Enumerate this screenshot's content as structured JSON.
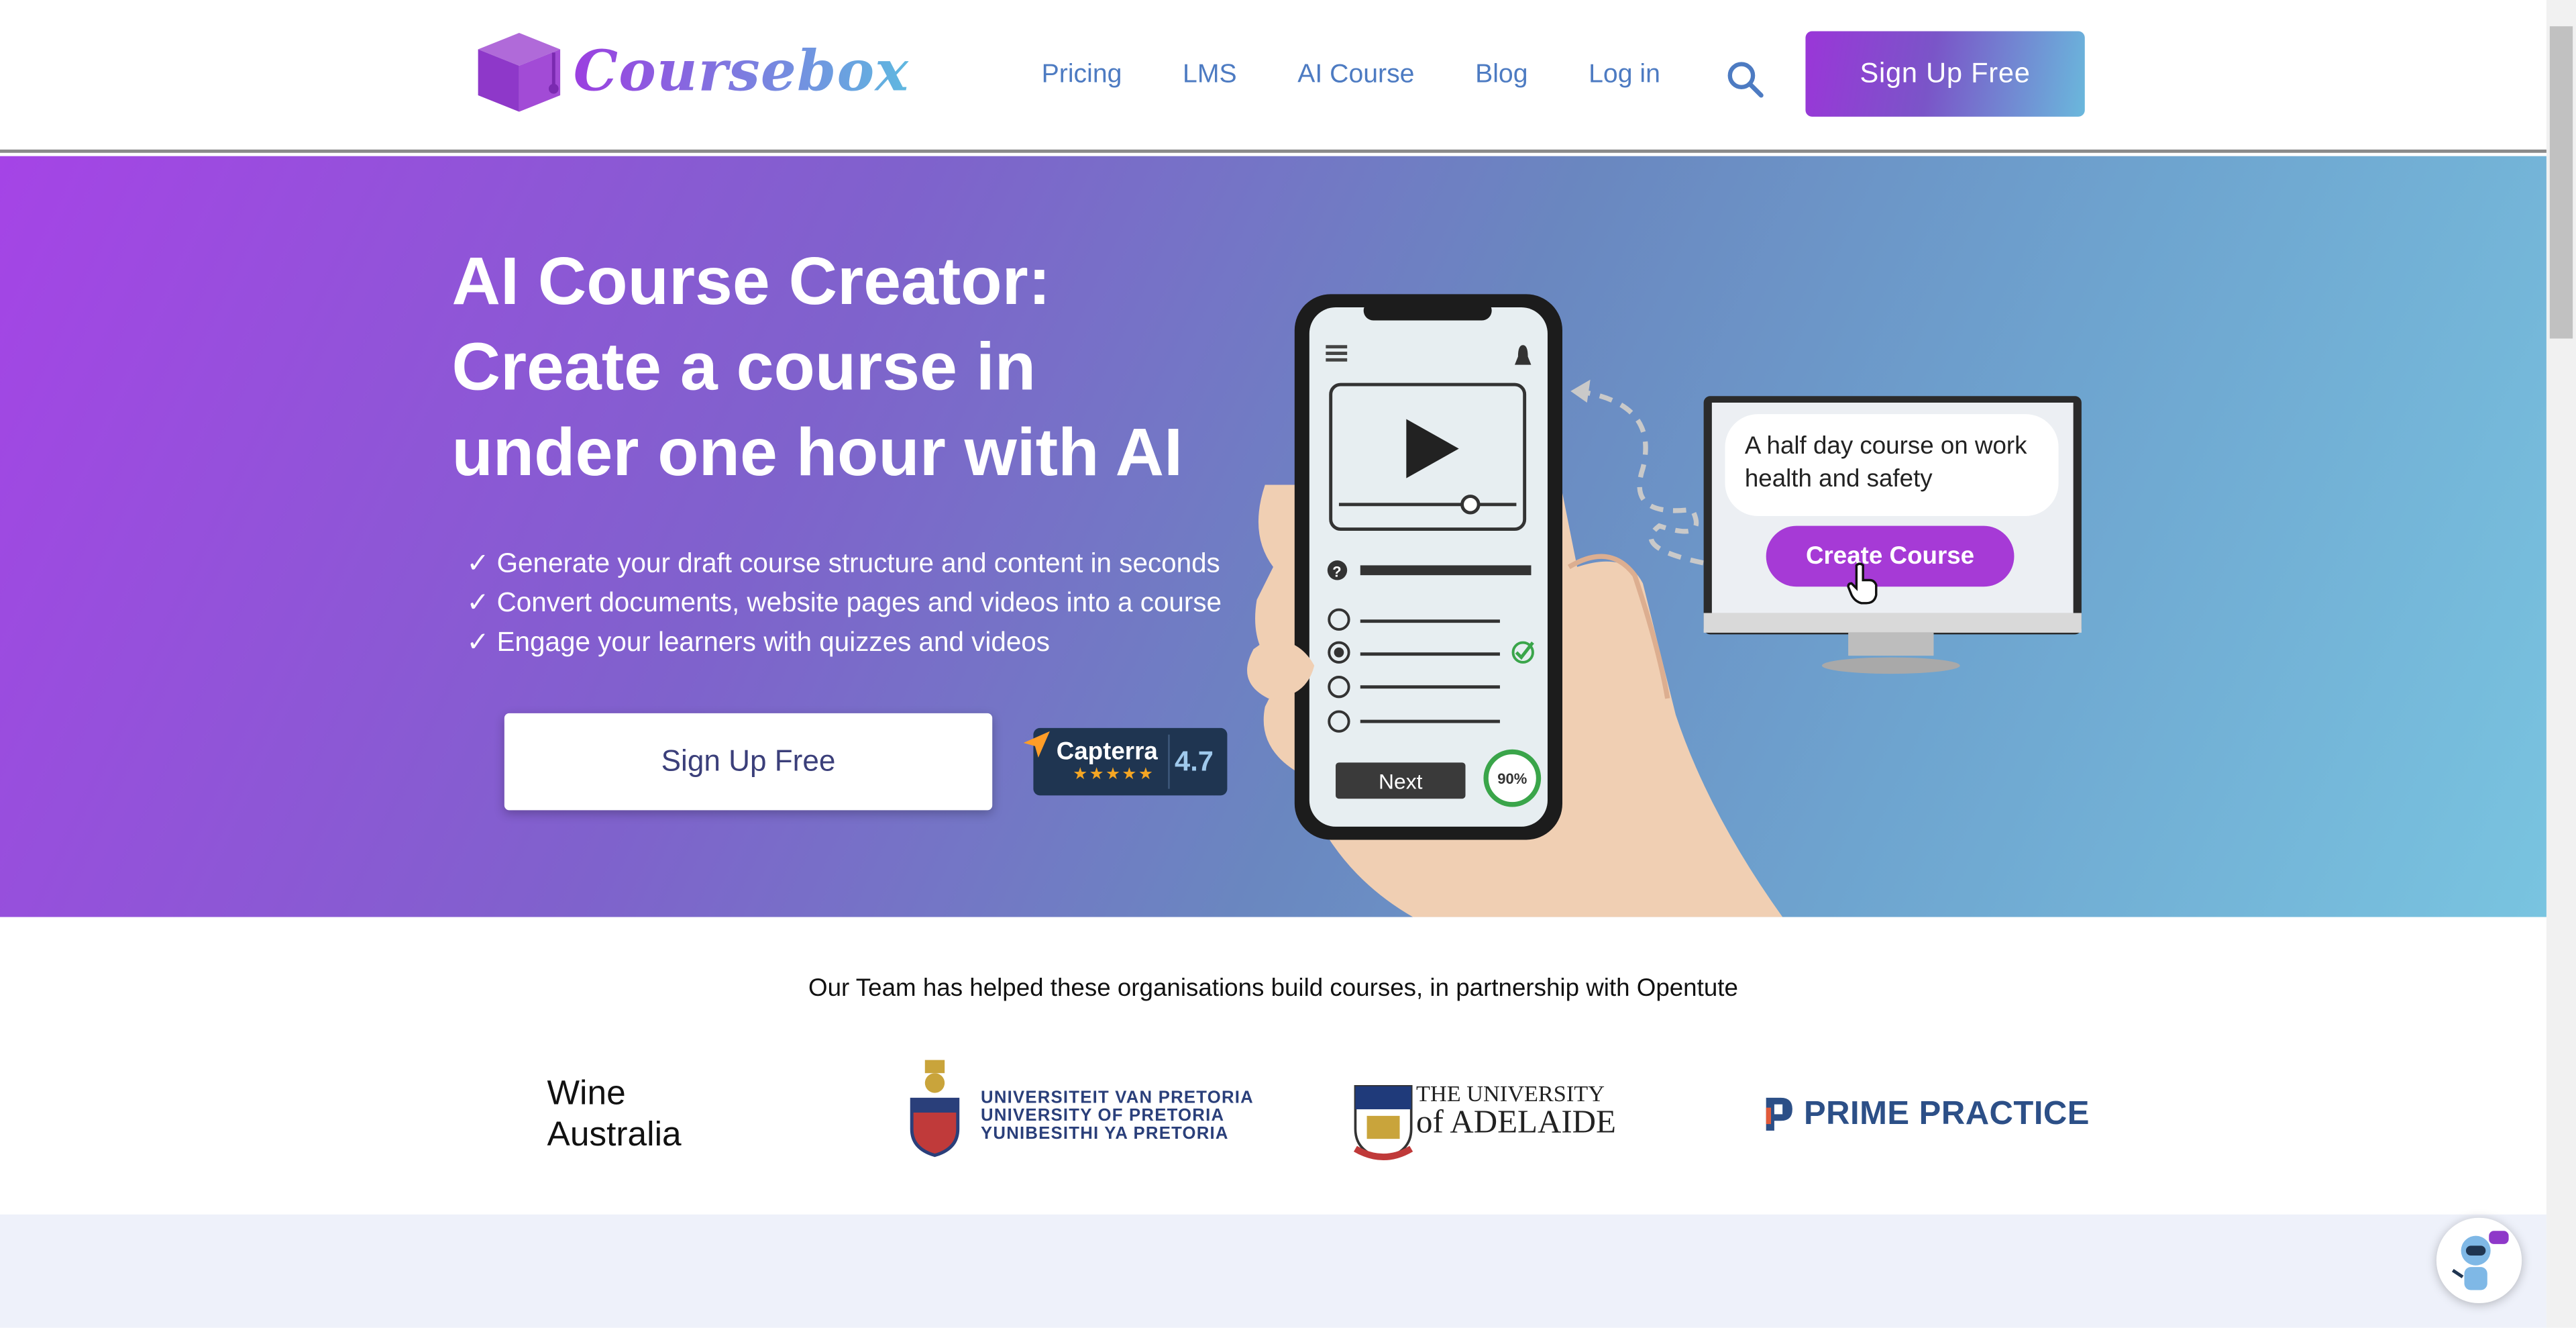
{
  "header": {
    "logo_text": "Coursebox",
    "nav": [
      "Pricing",
      "LMS",
      "AI Course",
      "Blog",
      "Log in"
    ],
    "signup_label": "Sign Up Free"
  },
  "hero": {
    "title_line1": "AI Course Creator:",
    "title_line2": "Create a course in",
    "title_line3": "under one hour with AI",
    "bullets": [
      "✓ Generate your draft course structure and content in seconds",
      "✓ Convert documents, website pages and videos into a course",
      "✓ Engage your learners with quizzes and videos"
    ],
    "cta_label": "Sign Up Free",
    "capterra": {
      "name": "Capterra",
      "score": "4.7",
      "stars": "★★★★★"
    },
    "illustration": {
      "bubble_text": "A half day course on work health and safety",
      "create_button": "Create Course",
      "next_button": "Next",
      "progress": "90%"
    }
  },
  "partners": {
    "heading": "Our Team has helped these organisations build courses, in partnership with Opentute",
    "wine_line1": "Wine",
    "wine_line2": "Australia",
    "pretoria_lines": [
      "UNIVERSITEIT VAN PRETORIA",
      "UNIVERSITY OF PRETORIA",
      "YUNIBESITHI YA PRETORIA"
    ],
    "adelaide_line1": "THE UNIVERSITY",
    "adelaide_line2": "of ADELAIDE",
    "prime": "PRIME PRACTICE"
  },
  "colors": {
    "brand_purple": "#9a36d8",
    "brand_blue": "#6ab8dc",
    "nav_link": "#4d7bc2"
  }
}
